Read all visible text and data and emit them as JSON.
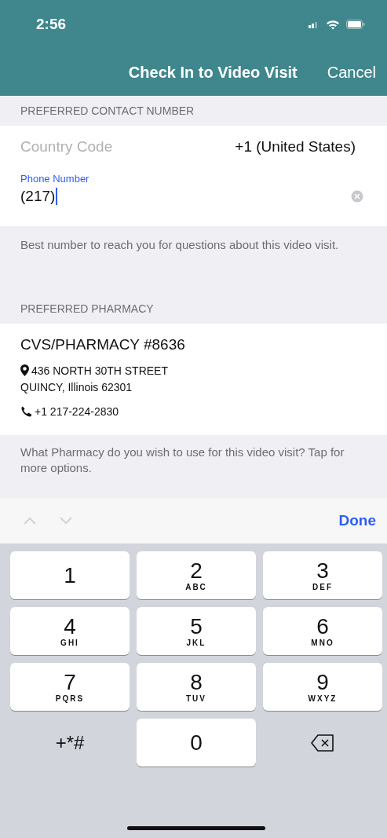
{
  "status_bar": {
    "time": "2:56"
  },
  "nav": {
    "title": "Check In to Video Visit",
    "cancel": "Cancel"
  },
  "contact": {
    "header": "PREFERRED CONTACT NUMBER",
    "country": {
      "label": "Country Code",
      "value": "+1 (United States)"
    },
    "phone": {
      "label": "Phone Number",
      "value": "(217)",
      "focused": true
    },
    "footer": "Best number to reach you for questions about this video visit."
  },
  "pharmacy": {
    "header": "PREFERRED PHARMACY",
    "name": "CVS/PHARMACY #8636",
    "address": [
      "436 NORTH 30TH STREET",
      "QUINCY, Illinois  62301"
    ],
    "phone": "+1 217-224-2830",
    "footer": "What Pharmacy do you wish to use for this video visit? Tap for more options."
  },
  "toolbar": {
    "arrows": [
      {
        "disabled": true
      },
      {
        "disabled": true
      }
    ],
    "done": "Done"
  },
  "keys": [
    {
      "kind": "digit",
      "digit": "1"
    },
    {
      "kind": "digit",
      "digit": "2",
      "letters": "ABC"
    },
    {
      "kind": "digit",
      "digit": "3",
      "letters": "DEF"
    },
    {
      "kind": "digit",
      "digit": "4",
      "letters": "GHI"
    },
    {
      "kind": "digit",
      "digit": "5",
      "letters": "JKL"
    },
    {
      "kind": "digit",
      "digit": "6",
      "letters": "MNO"
    },
    {
      "kind": "digit",
      "digit": "7",
      "letters": "PQRS"
    },
    {
      "kind": "digit",
      "digit": "8",
      "letters": "TUV"
    },
    {
      "kind": "digit",
      "digit": "9",
      "letters": "WXYZ"
    },
    {
      "kind": "symbols",
      "label": "+*#"
    },
    {
      "kind": "digit",
      "digit": "0"
    },
    {
      "kind": "delete"
    }
  ]
}
